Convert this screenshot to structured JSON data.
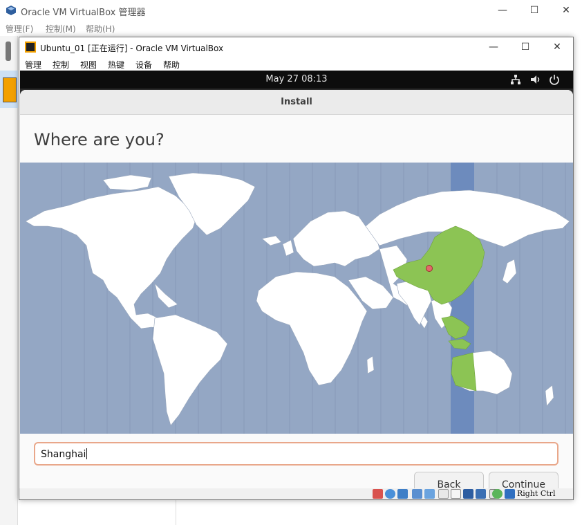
{
  "outer_window": {
    "title": "Oracle VM VirtualBox 管理器",
    "menu": [
      "管理(F)",
      "控制(M)",
      "帮助(H)"
    ],
    "controls": {
      "minimize": "—",
      "maximize": "☐",
      "close": "✕"
    }
  },
  "vm_window": {
    "title": "Ubuntu_01 [正在运行] - Oracle VM VirtualBox",
    "menu": [
      "管理",
      "控制",
      "视图",
      "热键",
      "设备",
      "帮助"
    ],
    "controls": {
      "minimize": "—",
      "maximize": "☐",
      "close": "✕"
    },
    "host_key": "Right Ctrl",
    "status_icons": [
      "hdd-icon",
      "optical-icon",
      "audio-icon",
      "network-icon",
      "usb-icon",
      "shared-folder-icon",
      "display-icon",
      "recording-icon",
      "vrde-icon",
      "vbox-icon",
      "mouse-integration-icon",
      "arrow-down-icon"
    ]
  },
  "gnome_bar": {
    "clock": "May 27  08:13",
    "indicators": [
      "network-icon",
      "volume-icon",
      "power-icon"
    ]
  },
  "installer": {
    "header": "Install",
    "heading": "Where are you?",
    "location_value": "Shanghai",
    "back_label": "Back",
    "continue_label": "Continue",
    "map": {
      "selected_region": "China",
      "highlight_color": "#8cc454",
      "ocean_color": "#94a7c4",
      "zone_band_color": "#6d8bbd"
    }
  }
}
